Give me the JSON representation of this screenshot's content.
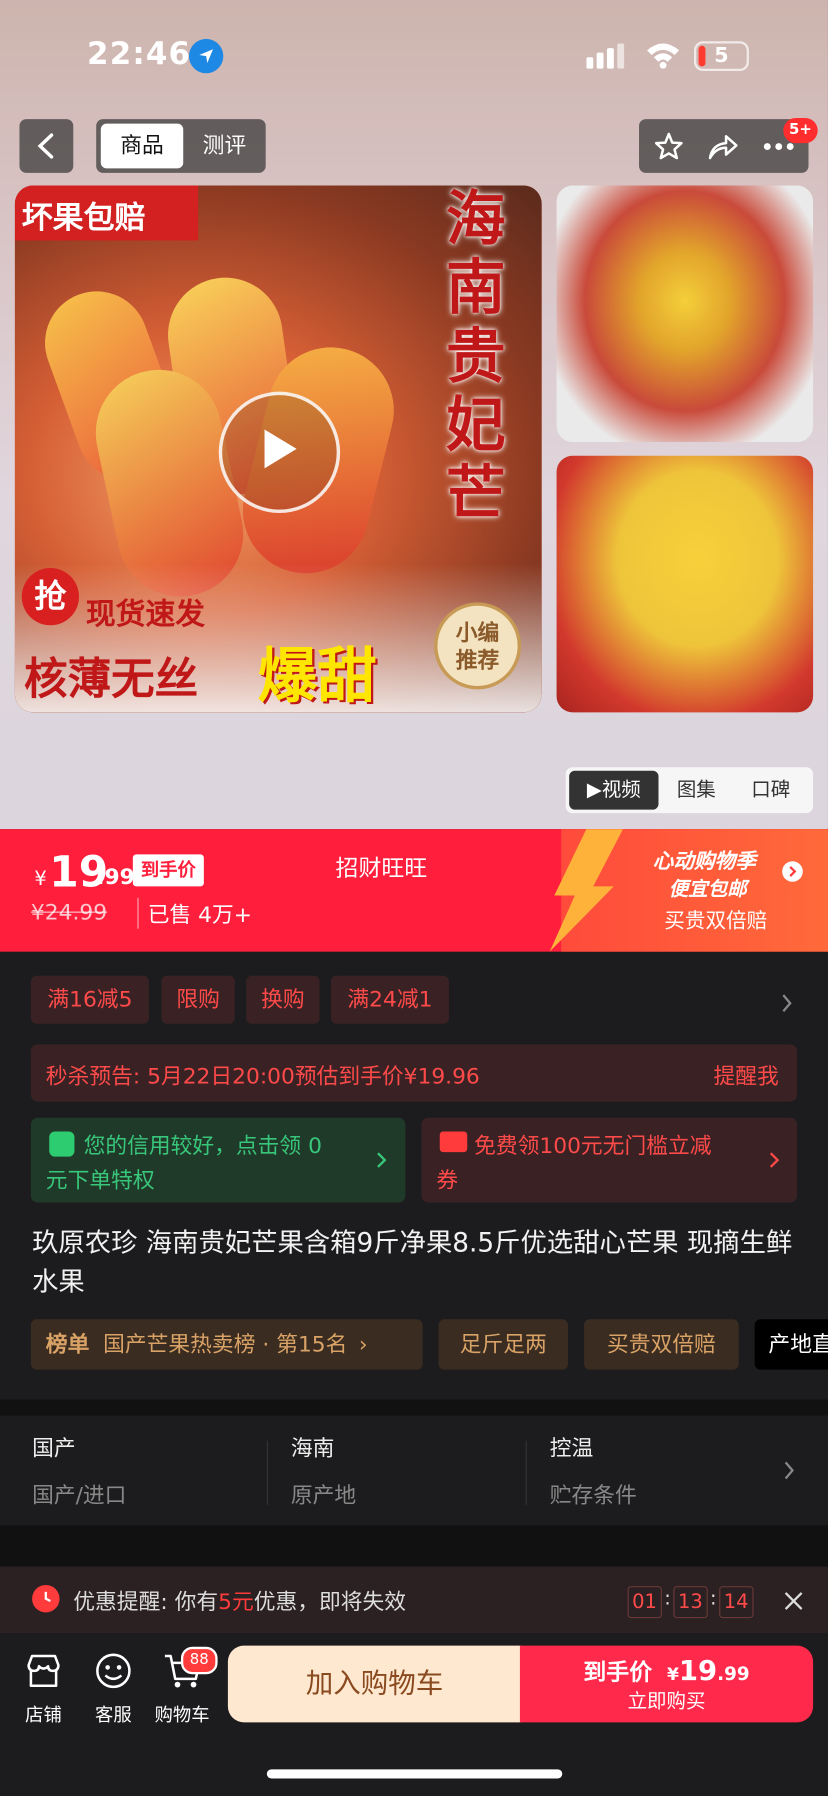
{
  "status_bar": {
    "time": "22:46",
    "battery": "5"
  },
  "nav": {
    "tabs": [
      "商品",
      "测评"
    ],
    "badge": "5+"
  },
  "main_image": {
    "badge_top": "坏果包赔",
    "vertical_title": [
      "海",
      "南",
      "贵",
      "妃",
      "芒"
    ],
    "grab": "抢",
    "fast": "现货速发",
    "slogan_left": "核薄无丝",
    "slogan_right": "爆甜",
    "stamp_line1": "小编",
    "stamp_line2": "推荐"
  },
  "media_tabs": [
    "▶视频",
    "图集",
    "口碑"
  ],
  "price": {
    "symbol": "¥",
    "integer": "19",
    "decimal": ".99",
    "tag": "到手价",
    "old_price": "¥24.99",
    "sold": "已售 4万+",
    "store": "招财旺旺",
    "promo_title": "心动购物季",
    "promo_sub": "便宜包邮",
    "promo_double": "买贵双倍赔"
  },
  "coupons": [
    "满16减5",
    "限购",
    "换购",
    "满24减1"
  ],
  "flash_sale": {
    "text": "秒杀预告: 5月22日20:00预估到手价¥19.96",
    "action": "提醒我"
  },
  "credit_card": {
    "line1": "您的信用较好，点击领 0",
    "line2": "元下单特权"
  },
  "coupon_card": {
    "line1": "免费领100元无门槛立减",
    "line2": "券"
  },
  "title": "玖原农珍 海南贵妃芒果含箱9斤净果8.5斤优选甜心芒果 现摘生鲜水果",
  "tags": {
    "ranking_prefix": "榜单",
    "ranking": "国产芒果热卖榜 · 第15名",
    "t1": "足斤足两",
    "t2": "买贵双倍赔",
    "t3": "产地直"
  },
  "specs": [
    {
      "value": "国产",
      "label": "国产/进口"
    },
    {
      "value": "海南",
      "label": "原产地"
    },
    {
      "value": "控温",
      "label": "贮存条件"
    }
  ],
  "notice": {
    "prefix": "优惠提醒: 你有",
    "amount": "5元",
    "suffix": "优惠，即将失效",
    "hh": "01",
    "mm": "13",
    "ss": "14"
  },
  "bottom": {
    "store": "店铺",
    "service": "客服",
    "cart": "购物车",
    "cart_count": "88",
    "add_cart": "加入购物车",
    "buy_prefix": "到手价",
    "buy_symbol": "¥",
    "buy_int": "19",
    "buy_dec": ".99",
    "buy_now": "立即购买"
  },
  "colors": {
    "accent": "#ff1f3d",
    "cart_bg": "#ffe8d0",
    "tag_gold": "#d9a266"
  }
}
